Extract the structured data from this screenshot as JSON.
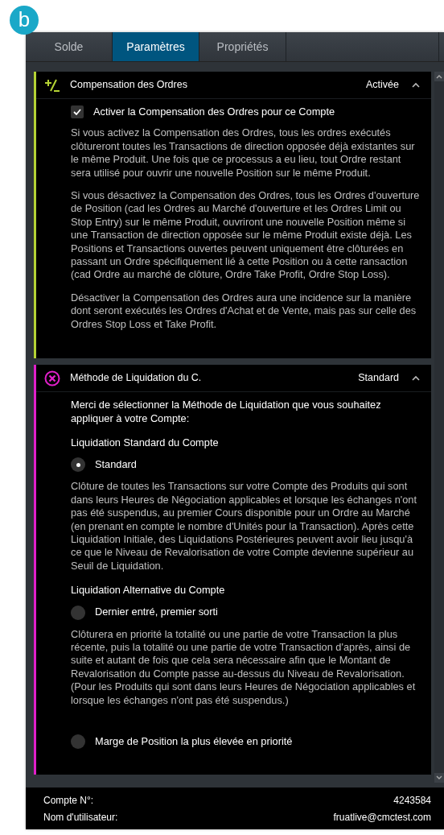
{
  "figure_label": "b",
  "tabs": [
    {
      "label": "Solde",
      "selected": false
    },
    {
      "label": "Paramètres",
      "selected": true
    },
    {
      "label": "Propriétés",
      "selected": false
    }
  ],
  "sections": [
    {
      "title": "Compensation des Ordres",
      "value": "Activée",
      "expanded": true,
      "color": "#b5d334",
      "content": [
        {
          "kind": "checkbox",
          "label": "Activer la Compensation des Ordres pour ce Compte",
          "checked": true
        },
        {
          "kind": "paragraph",
          "text": "Si vous activez la Compensation des Ordres, tous les ordres exécutés clôtureront toutes les Transactions de direction opposée déjà existantes sur le même Produit. Une fois que ce processus a eu lieu, tout Ordre restant sera utilisé pour ouvrir une nouvelle Position sur le même Produit."
        },
        {
          "kind": "paragraph",
          "text": "Si vous désactivez la Compensation des Ordres, tous les Ordres d'ouverture de Position (cad les Ordres au Marché d'ouverture et les Ordres Limit ou Stop Entry) sur le même Produit, ouvriront une nouvelle Position même si une Transaction de direction opposée sur le même Produit existe déjà. Les Positions et Transactions ouvertes peuvent uniquement être clôturées en passant un Ordre spécifiquement lié à cette Position ou à cette ransaction (cad Ordre au marché de clôture, Ordre Take Profit, Ordre Stop Loss)."
        },
        {
          "kind": "paragraph",
          "text": "Désactiver la Compensation des Ordres aura une incidence sur la manière dont seront exécutés les Ordres d'Achat et de Vente, mais pas sur celle des Ordres Stop Loss et Take Profit."
        }
      ]
    },
    {
      "title": "Méthode de Liquidation du C.",
      "value": "Standard",
      "expanded": true,
      "color": "#e020c8",
      "content": [
        {
          "kind": "intro",
          "text": "Merci de sélectionner la Méthode de Liquidation que vous souhaitez appliquer à votre Compte:"
        },
        {
          "kind": "subheading",
          "text": "Liquidation Standard du Compte"
        },
        {
          "kind": "radio",
          "label": "Standard",
          "selected": true
        },
        {
          "kind": "paragraph",
          "text": "Clôture de toutes les Transactions sur votre Compte des Produits qui sont dans leurs Heures de Négociation applicables et lorsque les échanges n'ont pas été suspendus, au premier Cours disponible pour un Ordre au Marché (en prenant en compte le nombre d'Unités pour la Transaction). Après cette Liquidation Initiale, des Liquidations Postérieures peuvent avoir lieu jusqu'à ce que le Niveau de Revalorisation de votre Compte devienne supérieur au Seuil de Liquidation."
        },
        {
          "kind": "subheading",
          "text": "Liquidation Alternative du Compte"
        },
        {
          "kind": "radio",
          "label": "Dernier entré, premier sorti",
          "selected": false
        },
        {
          "kind": "paragraph",
          "text": "Clôturera en priorité la totalité ou une partie de votre Transaction la plus récente, puis la totalité ou une partie de votre Transaction d'après, ainsi de suite et autant de fois que cela sera nécessaire afin que le Montant de Revalorisation du Compte passe au-dessus du Niveau de Revalorisation.\n(Pour les Produits qui sont dans leurs Heures de Négociation applicables et lorsque les échanges n'ont pas été suspendus.)"
        },
        {
          "kind": "radio",
          "label": "Marge de Position la plus élevée en priorité",
          "selected": false
        }
      ]
    }
  ],
  "footer": [
    {
      "label": "Compte N°:",
      "value": "4243584"
    },
    {
      "label": "Nom d'utilisateur:",
      "value": "fruatlive@cmctest.com"
    }
  ]
}
